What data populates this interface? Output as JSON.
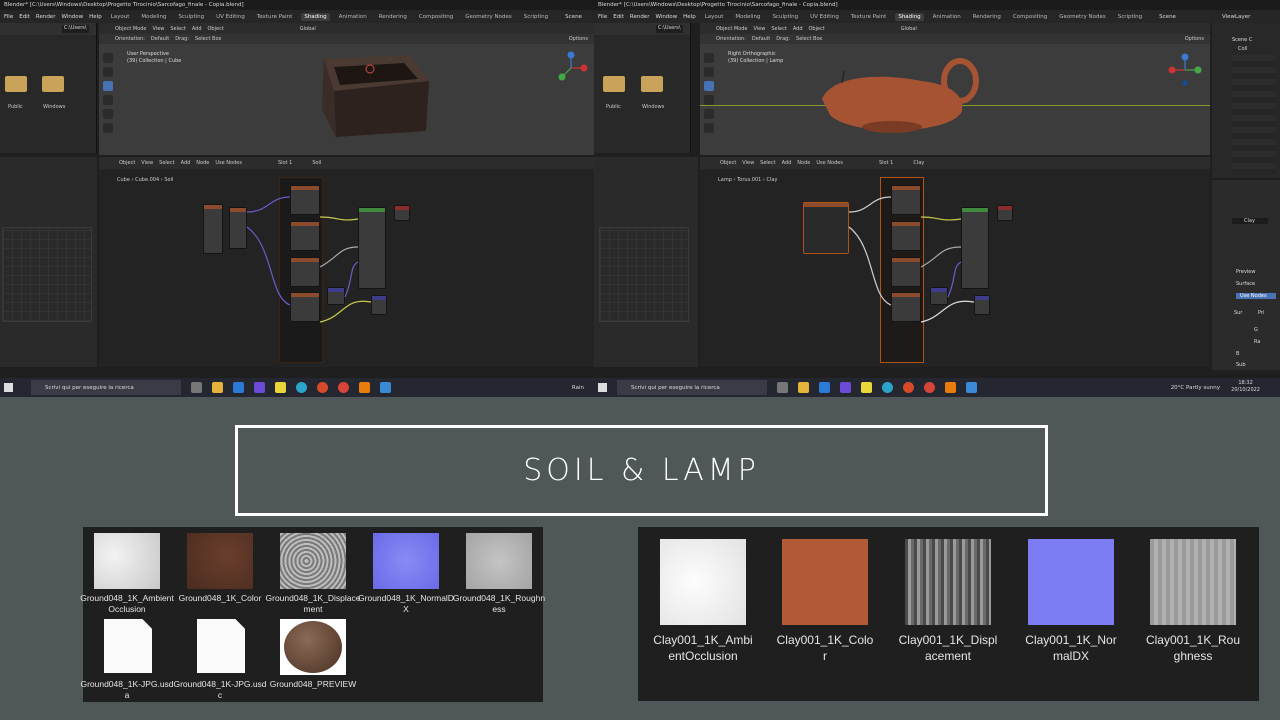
{
  "left_window": {
    "title": "Blender* [C:\\Users\\Windows\\Desktop\\Progetto Tirocinio\\Sarcofago_finale - Copia.blend]",
    "menu": [
      "File",
      "Edit",
      "Render",
      "Window",
      "Help"
    ],
    "workspaces": [
      "Layout",
      "Modeling",
      "Sculpting",
      "UV Editing",
      "Texture Paint",
      "Shading",
      "Animation",
      "Rendering",
      "Compositing",
      "Geometry Nodes",
      "Scripting"
    ],
    "active_workspace": "Shading",
    "scene": "Scene",
    "filebrowser": {
      "path": "C:\\Users\\",
      "folders": [
        "Public",
        "Windows"
      ]
    },
    "viewport": {
      "mode": "Object Mode",
      "menus": [
        "View",
        "Select",
        "Add",
        "Object"
      ],
      "orientation_label": "Orientation:",
      "orientation": "Default",
      "drag_label": "Drag:",
      "drag": "Select Box",
      "transform": "Global",
      "options": "Options",
      "view_name": "User Perspective",
      "collection": "(39) Collection | Cube"
    },
    "node_editor": {
      "type": "Object",
      "menus": [
        "View",
        "Select",
        "Add",
        "Node"
      ],
      "use_nodes": "Use Nodes",
      "slot": "Slot 1",
      "material": "Soil",
      "breadcrumb": [
        "Cube",
        "Cube.004",
        "Soil"
      ],
      "new": "New",
      "open": "Open"
    }
  },
  "right_window": {
    "title": "Blender* [C:\\Users\\Windows\\Desktop\\Progetto Tirocinio\\Sarcofago_finale - Copia.blend]",
    "menu": [
      "File",
      "Edit",
      "Render",
      "Window",
      "Help"
    ],
    "workspaces": [
      "Layout",
      "Modeling",
      "Sculpting",
      "UV Editing",
      "Texture Paint",
      "Shading",
      "Animation",
      "Rendering",
      "Compositing",
      "Geometry Nodes",
      "Scripting"
    ],
    "active_workspace": "Shading",
    "scene": "Scene",
    "view_layer": "ViewLayer",
    "filebrowser": {
      "path": "C:\\Users\\",
      "folders": [
        "Public",
        "Windows"
      ]
    },
    "viewport": {
      "mode": "Object Mode",
      "menus": [
        "View",
        "Select",
        "Add",
        "Object"
      ],
      "orientation_label": "Orientation:",
      "orientation": "Default",
      "drag_label": "Drag:",
      "drag": "Select Box",
      "transform": "Global",
      "options": "Options",
      "view_name": "Right Orthographic",
      "collection": "(39) Collection | Lamp"
    },
    "node_editor": {
      "type": "Object",
      "menus": [
        "View",
        "Select",
        "Add",
        "Node"
      ],
      "use_nodes": "Use Nodes",
      "slot": "Slot 1",
      "material": "Clay",
      "breadcrumb": [
        "Lamp",
        "Torus.001",
        "Clay"
      ],
      "new": "New",
      "open": "Open"
    },
    "outliner": {
      "scene_collection": "Scene C",
      "coll": "Coll"
    },
    "properties": {
      "material": "Clay",
      "preview": "Preview",
      "surface": "Surface",
      "use_nodes": "Use Nodes",
      "surface_label": "Sur",
      "surface_value": "Pri",
      "row_g": "G",
      "row_ra": "Ra",
      "row_b": "B",
      "row_sub": "Sub"
    }
  },
  "taskbar_left": {
    "search_placeholder": "Scrivi qui per eseguire la ricerca",
    "weather": "Rain"
  },
  "taskbar_right": {
    "search_placeholder": "Scrivi qui per eseguire la ricerca",
    "weather": "20°C  Partly sunny",
    "time": "18:32",
    "date": "20/10/2022"
  },
  "heading": "SOIL & LAMP",
  "soil_textures": [
    {
      "label": "Ground048_1K_AmbientOcclusion",
      "color": "#d6d6d6"
    },
    {
      "label": "Ground048_1K_Color",
      "color": "#5a3425"
    },
    {
      "label": "Ground048_1K_Displacement",
      "color": "#9a9a9a"
    },
    {
      "label": "Ground048_1K_NormalDX",
      "color": "#7a7af2"
    },
    {
      "label": "Ground048_1K_Roughness",
      "color": "#b5b5b5"
    },
    {
      "label": "Ground048_1K-JPG.usda",
      "color": "#fafafa"
    },
    {
      "label": "Ground048_1K-JPG.usdc",
      "color": "#fafafa"
    },
    {
      "label": "Ground048_PREVIEW",
      "color": "#6a4a3a"
    }
  ],
  "clay_textures": [
    {
      "label": "Clay001_1K_AmbientOcclusion",
      "color": "#f2f2f2"
    },
    {
      "label": "Clay001_1K_Color",
      "color": "#b15a36"
    },
    {
      "label": "Clay001_1K_Displacement",
      "color": "#7b7b7b"
    },
    {
      "label": "Clay001_1K_NormalDX",
      "color": "#7d7cf3"
    },
    {
      "label": "Clay001_1K_Roughness",
      "color": "#a5a5a5"
    }
  ]
}
